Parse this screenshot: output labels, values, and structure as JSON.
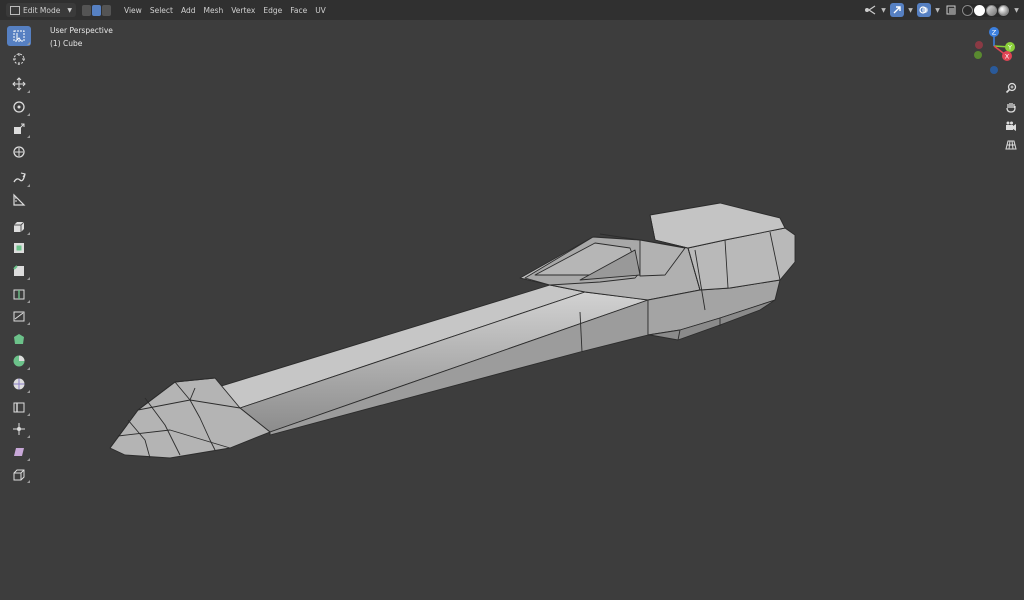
{
  "header": {
    "mode": "Edit Mode",
    "menus": [
      "View",
      "Select",
      "Add",
      "Mesh",
      "Vertex",
      "Edge",
      "Face",
      "UV"
    ]
  },
  "viewport": {
    "perspective": "User Perspective",
    "object": "(1) Cube"
  },
  "toolbar": {
    "tools": [
      "select-box",
      "cursor",
      "move",
      "rotate",
      "scale",
      "transform",
      "annotate",
      "measure",
      "extrude-region",
      "inset-faces",
      "bevel",
      "loop-cut",
      "knife",
      "poly-build",
      "spin",
      "smooth",
      "edge-slide",
      "shrink-fatten",
      "shear",
      "rip-region"
    ]
  },
  "gizmo": {
    "axes": [
      "Z",
      "Y",
      "X"
    ]
  },
  "colors": {
    "accent": "#5680c2",
    "x_axis": "#e04454",
    "y_axis": "#8ad03a",
    "z_axis": "#3c80e0"
  }
}
